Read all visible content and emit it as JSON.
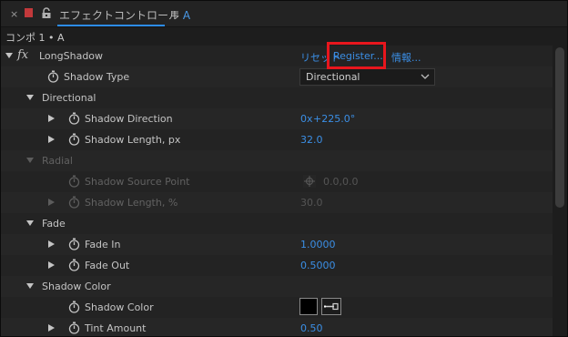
{
  "panel": {
    "close_glyph": "×",
    "title_main": "エフェクトコントロール",
    "title_accent": "A",
    "menu_glyph": "≡",
    "comp_path": "コンポ 1 • A"
  },
  "effect": {
    "fx_glyph": "fx",
    "name": "LongShadow",
    "reset_label": "リセット",
    "register_label": "Register...",
    "info_label": "情報..."
  },
  "params": {
    "shadow_type": {
      "label": "Shadow Type",
      "value": "Directional"
    },
    "directional": {
      "label": "Directional"
    },
    "shadow_direction": {
      "label": "Shadow Direction",
      "value_turns": "0x",
      "value_angle": "+225.0°"
    },
    "shadow_length_px": {
      "label": "Shadow Length, px",
      "value": "32.0"
    },
    "radial": {
      "label": "Radial"
    },
    "shadow_source_point": {
      "label": "Shadow Source Point",
      "value": "0.0,0.0"
    },
    "shadow_length_pct": {
      "label": "Shadow Length, %",
      "value": "30.0"
    },
    "fade": {
      "label": "Fade"
    },
    "fade_in": {
      "label": "Fade In",
      "value": "1.0000"
    },
    "fade_out": {
      "label": "Fade Out",
      "value": "0.5000"
    },
    "shadow_color_group": {
      "label": "Shadow Color"
    },
    "shadow_color": {
      "label": "Shadow Color",
      "swatch": "#000000"
    },
    "tint_amount": {
      "label": "Tint Amount",
      "value": "0.50"
    }
  },
  "colors": {
    "accent": "#3b8fe6",
    "highlight_box": "#e8161d",
    "label_swatch": "#c2393b"
  }
}
